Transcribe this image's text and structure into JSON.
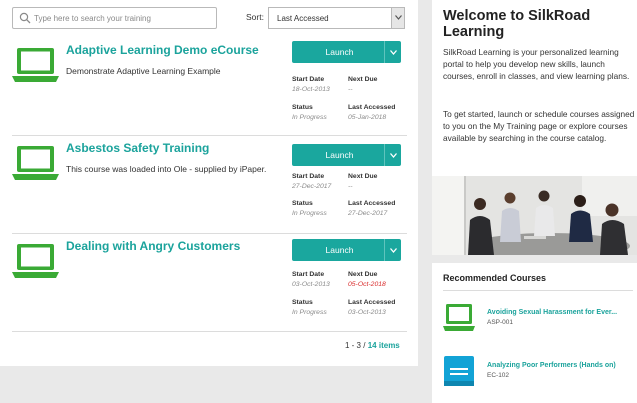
{
  "search": {
    "placeholder": "Type here to search your training"
  },
  "sort": {
    "label": "Sort:",
    "selected": "Last Accessed"
  },
  "launch_label": "Launch",
  "field_labels": {
    "start_date": "Start Date",
    "next_due": "Next Due",
    "status": "Status",
    "last_accessed": "Last Accessed"
  },
  "courses": [
    {
      "title": "Adaptive Learning Demo eCourse",
      "description": "Demonstrate Adaptive Learning Example",
      "start_date": "18-Oct-2013",
      "next_due": "--",
      "status": "In Progress",
      "last_accessed": "05-Jan-2018",
      "icon": "laptop-icon"
    },
    {
      "title": "Asbestos Safety Training",
      "description": "This course was loaded into Ole - supplied by iPaper.",
      "start_date": "27-Dec-2017",
      "next_due": "--",
      "status": "In Progress",
      "last_accessed": "27-Dec-2017",
      "icon": "laptop-icon"
    },
    {
      "title": "Dealing with Angry Customers",
      "description": "",
      "start_date": "03-Oct-2013",
      "next_due": "05-Oct-2018",
      "status": "In Progress",
      "last_accessed": "03-Oct-2013",
      "icon": "laptop-icon",
      "next_due_color": "#d92b2b"
    }
  ],
  "pagination": {
    "range": "1 - 3",
    "separator": "/",
    "total": "14",
    "items_label": "items"
  },
  "welcome": {
    "title": "Welcome to SilkRoad Learning",
    "paragraph1": "SilkRoad Learning is your personalized learning portal to help you develop new skills, launch courses, enroll in classes, and view learning plans.",
    "paragraph2": "To get started, launch or schedule courses assigned to you on the My Training page or explore courses available by searching in the course catalog."
  },
  "recommended": {
    "heading": "Recommended Courses",
    "items": [
      {
        "title": "Avoiding Sexual Harassment for Ever...",
        "code": "ASP-001",
        "icon": "laptop-icon"
      },
      {
        "title": "Analyzing Poor Performers (Hands on)",
        "code": "EC-102",
        "icon": "book-icon"
      }
    ]
  },
  "colors": {
    "accent": "#1ba39c",
    "launch_button": "#1aa79e",
    "icon_green": "#3aaa35",
    "icon_blue": "#12a3d6",
    "overdue": "#d92b2b"
  }
}
